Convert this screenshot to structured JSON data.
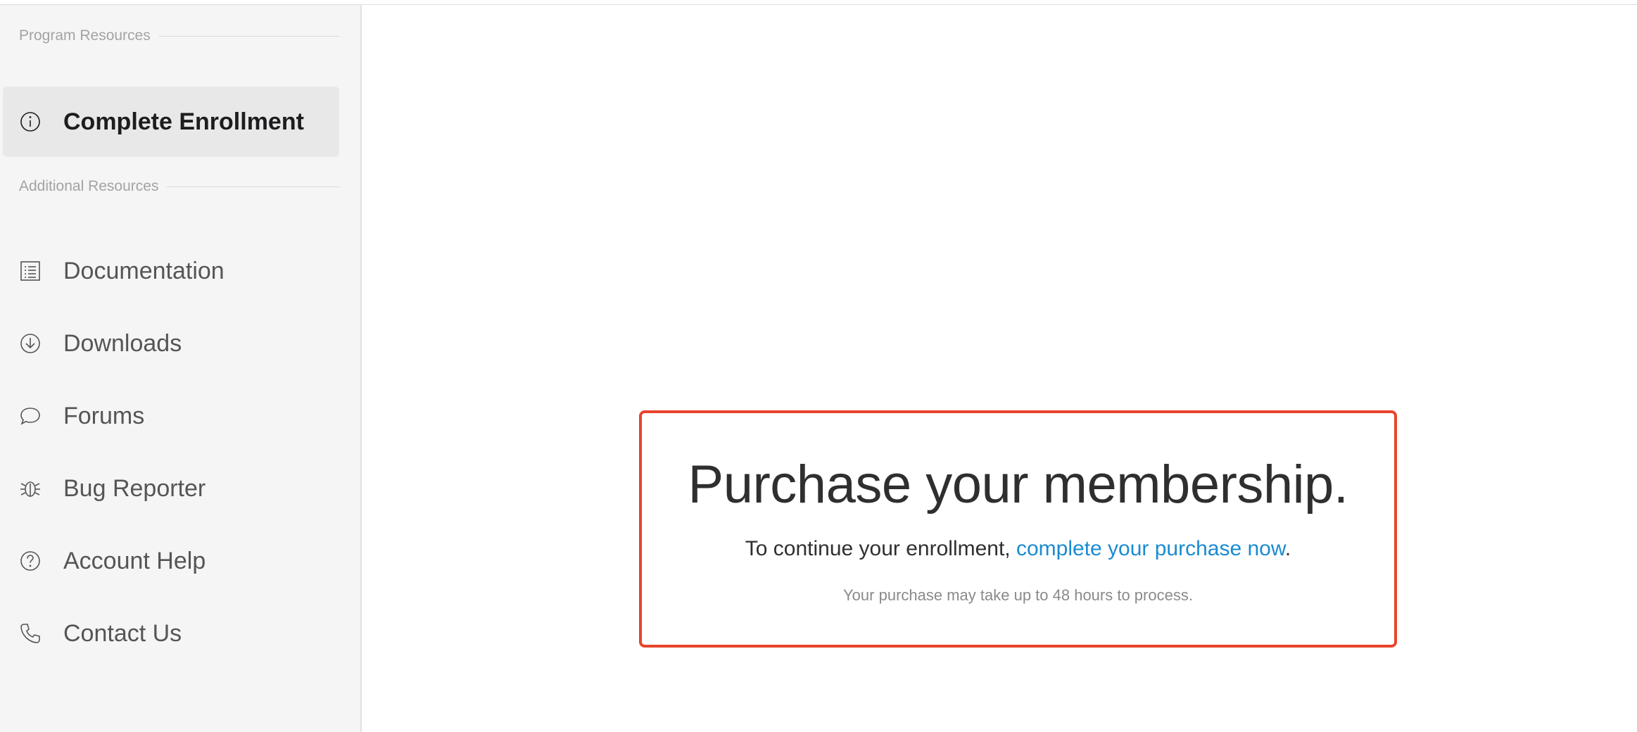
{
  "sidebar": {
    "program_section_label": "Program Resources",
    "additional_section_label": "Additional Resources",
    "active_item": {
      "label": "Complete Enrollment",
      "icon": "info-circle-icon"
    },
    "items": [
      {
        "label": "Documentation",
        "icon": "document-list-icon"
      },
      {
        "label": "Downloads",
        "icon": "download-circle-icon"
      },
      {
        "label": "Forums",
        "icon": "speech-bubble-icon"
      },
      {
        "label": "Bug Reporter",
        "icon": "bug-icon"
      },
      {
        "label": "Account Help",
        "icon": "question-circle-icon"
      },
      {
        "label": "Contact Us",
        "icon": "phone-icon"
      }
    ]
  },
  "main": {
    "promo": {
      "title": "Purchase your membership.",
      "line_prefix": "To continue your enrollment, ",
      "link_text": "complete your purchase now",
      "line_suffix": ".",
      "note": "Your purchase may take up to 48 hours to process."
    }
  },
  "colors": {
    "highlight_border": "#e8442d",
    "link": "#1a8bd1",
    "sidebar_bg": "#f5f5f5",
    "active_item_bg": "#e8e8e8"
  }
}
